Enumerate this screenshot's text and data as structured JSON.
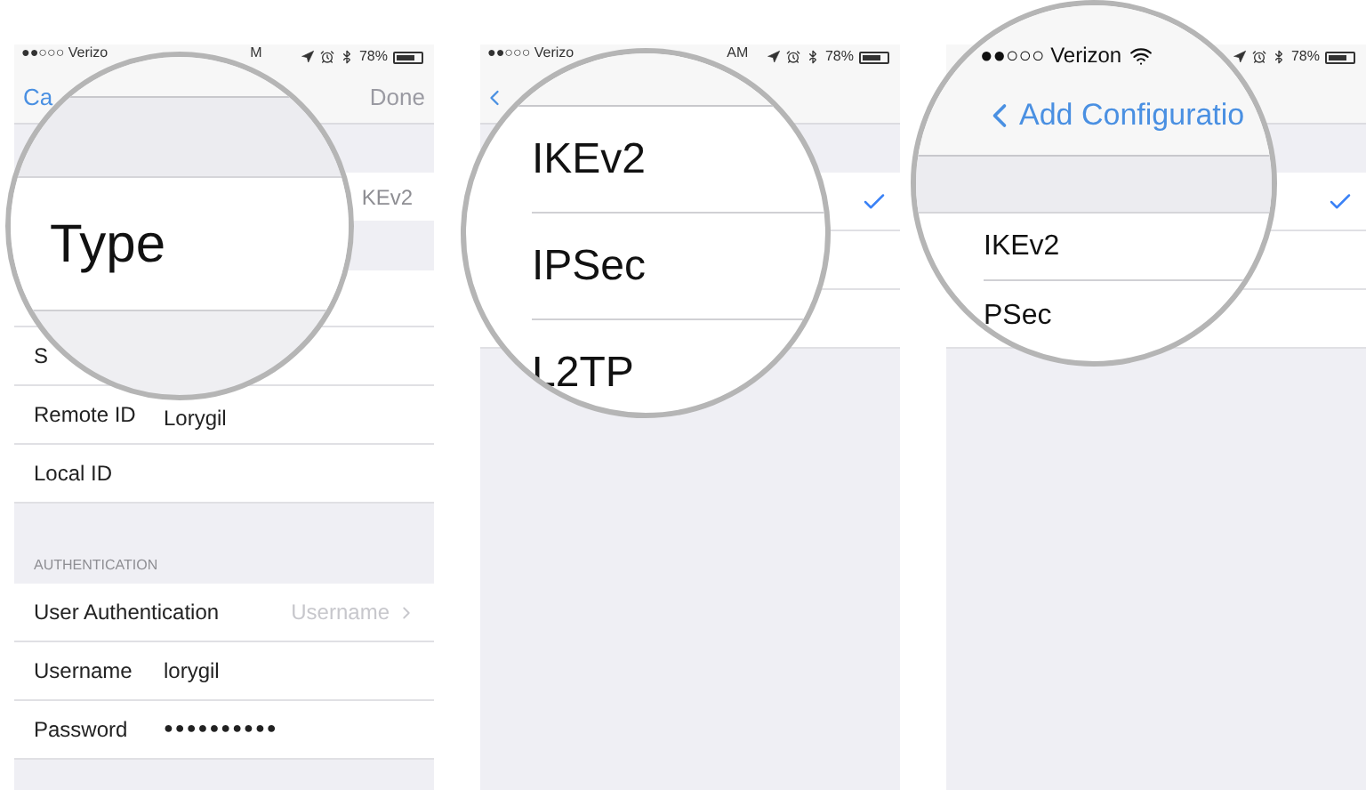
{
  "screens": [
    {
      "status_bar": {
        "carrier": "●●○○○ Verizo",
        "time": "M",
        "battery": "78%"
      },
      "nav": {
        "back": "Ca",
        "done": "Done",
        "done_disabled": true
      },
      "type_value": "KEv2",
      "rows": [
        {
          "label": "S"
        },
        {
          "label": "Remote ID",
          "value": "Lorygil"
        },
        {
          "label": "Local ID"
        }
      ],
      "section": "AUTHENTICATION",
      "auth_rows": [
        {
          "kind": "disclosure",
          "label": "User Authentication",
          "value": "Username"
        },
        {
          "kind": "text",
          "label": "Username",
          "value": "lorygil"
        },
        {
          "kind": "secure",
          "label": "Password",
          "value": "●●●●●●●●●●"
        }
      ],
      "magnifier": {
        "label": "Type"
      }
    },
    {
      "status_bar": {
        "carrier": "●●○○○ Verizo",
        "time": "AM",
        "battery": "78%"
      },
      "rows": [
        {
          "selected": true
        },
        {
          "selected": false
        },
        {
          "selected": false
        }
      ],
      "magnifier": {
        "items": [
          "IKEv2",
          "IPSec",
          "L2TP"
        ]
      }
    },
    {
      "status_bar": {
        "battery": "78%"
      },
      "rows": [
        {
          "selected": true
        },
        {
          "selected": false
        },
        {
          "selected": false
        }
      ],
      "magnifier": {
        "carrier": "●●○○○ Verizon",
        "back": "Add Configuratio",
        "items": [
          "IKEv2",
          "PSec"
        ]
      }
    }
  ]
}
